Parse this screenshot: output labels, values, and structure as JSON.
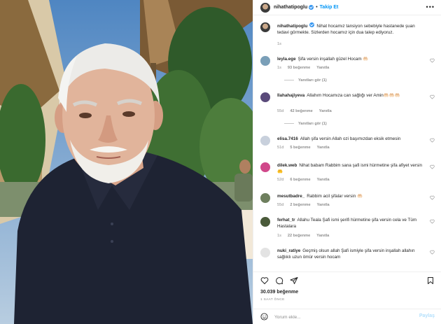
{
  "post": {
    "username": "nihathatipoglu",
    "follow_label": "Takip Et",
    "more_label": "•••",
    "separator": "•",
    "caption": "Nihat hocamız tansiyon sebebiyle hastanede şuan tedavi görmekte. Sizlerden hocamız için dua talep ediyoruz.",
    "caption_age": "1s",
    "likes": "30.039 beğenme",
    "posted": "1 SAAT ÖNCE"
  },
  "comments": [
    {
      "user": "leyla.ege",
      "text": "Şifa versin inşallah güzel Hocam 🤲🏻",
      "age": "1s",
      "likes": "93 beğenme",
      "reply": "Yanıtla",
      "view_replies": "Yanıtları gör (1)"
    },
    {
      "user": "llahahajiyeva",
      "text": "Allahım Hocamıza can sağlığı ver Amin🤲🏻🤲🏻🤲🏻",
      "age": "55d",
      "likes": "42 beğenme",
      "reply": "Yanıtla",
      "view_replies": "Yanıtları gör (1)"
    },
    {
      "user": "elisa.7416",
      "text": "Allah şifa versin Allah ozi başımızdan eksik etmesin",
      "age": "51d",
      "likes": "5 beğenme",
      "reply": "Yanıtla",
      "view_replies": ""
    },
    {
      "user": "dilek.web",
      "text": "Nihat babam Rabbim sana şafi ismi hürmetine şifa afiyet versin🤲",
      "age": "52d",
      "likes": "6 beğenme",
      "reply": "Yanıtla",
      "view_replies": ""
    },
    {
      "user": "mesutbadre_",
      "text": "Rabbim acil şifalar versin 🤲🏻",
      "age": "55d",
      "likes": "2 beğenme",
      "reply": "Yanıtla",
      "view_replies": ""
    },
    {
      "user": "ferhat_tr",
      "text": "Allahu Teala Şafi ismi şerifi hürmetine şifa versin cela ve Tüm Hastalara",
      "age": "1s",
      "likes": "22 beğenme",
      "reply": "Yanıtla",
      "view_replies": ""
    },
    {
      "user": "nuki_ratiye",
      "text": "Geçmiş olsun allah Şafi ismiyle şifa versin inşallah allahın sağlıklı uzun ömür versin hocam",
      "age": "",
      "likes": "",
      "reply": "",
      "view_replies": ""
    }
  ],
  "composer": {
    "placeholder": "Yorum ekle...",
    "share_label": "Paylaş"
  },
  "colors": {
    "link_blue": "#0095f6",
    "verified_blue": "#3897f0",
    "muted": "#8e8e8e"
  },
  "icons": [
    "heart-icon",
    "comment-icon",
    "share-icon",
    "bookmark-icon",
    "emoji-icon",
    "verified-icon",
    "more-icon"
  ]
}
